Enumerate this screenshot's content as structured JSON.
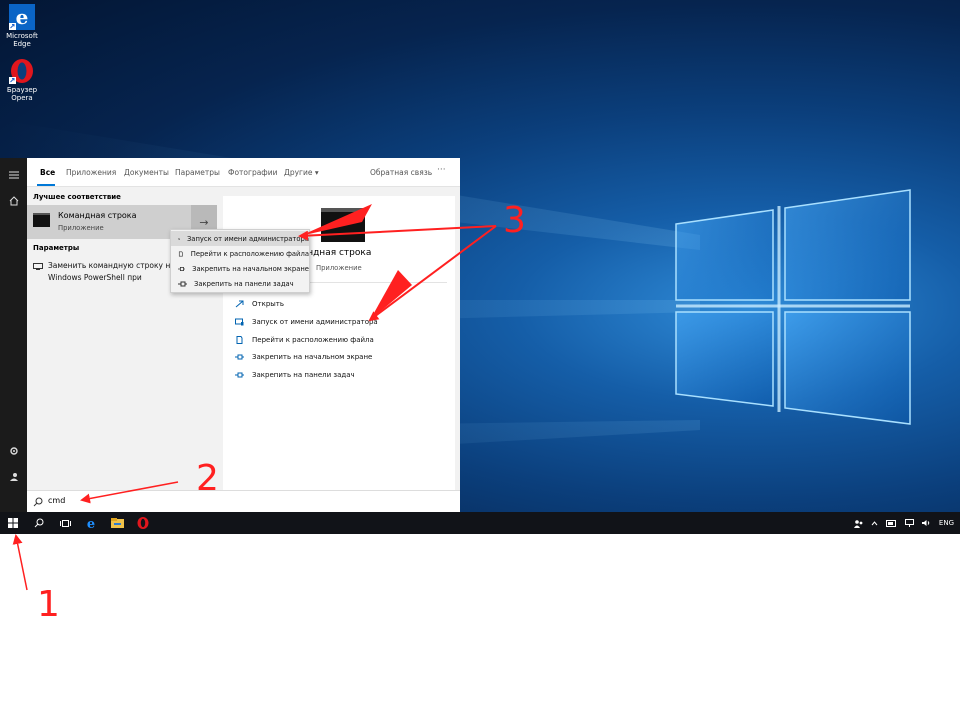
{
  "desktop": {
    "icons": [
      {
        "label_line1": "Microsoft",
        "label_line2": "Edge",
        "icon": "edge-icon"
      },
      {
        "label_line1": "Браузер",
        "label_line2": "Opera",
        "icon": "opera-icon"
      }
    ],
    "accent": "#0b3f7c"
  },
  "start_menu": {
    "tabs": [
      {
        "label": "Все"
      },
      {
        "label": "Приложения"
      },
      {
        "label": "Документы"
      },
      {
        "label": "Параметры"
      },
      {
        "label": "Фотографии"
      },
      {
        "label": "Другие ▾"
      }
    ],
    "feedback": "Обратная связь",
    "more": "···",
    "best_match_title": "Лучшее соответствие",
    "best_match": {
      "name": "Командная строка",
      "type": "Приложение",
      "arrow": "→"
    },
    "settings_title": "Параметры",
    "settings_item": {
      "line1": "Заменить командную строку на",
      "line2": "Windows PowerShell при"
    },
    "preview": {
      "name": "Командная строка",
      "type": "Приложение"
    },
    "actions": [
      {
        "label": "Открыть",
        "icon": "open-icon"
      },
      {
        "label": "Запуск от имени администратора",
        "icon": "run-as-admin-icon"
      },
      {
        "label": "Перейти к расположению файла",
        "icon": "file-location-icon"
      },
      {
        "label": "Закрепить на начальном экране",
        "icon": "pin-start-icon"
      },
      {
        "label": "Закрепить на панели задач",
        "icon": "pin-taskbar-icon"
      }
    ],
    "search_value": "cmd"
  },
  "context_menu": {
    "items": [
      {
        "label": "Запуск от имени администратора",
        "highlighted": true
      },
      {
        "label": "Перейти к расположению файла",
        "highlighted": false
      },
      {
        "label": "Закрепить на начальном экране",
        "highlighted": false
      },
      {
        "label": "Закрепить на панели задач",
        "highlighted": false
      }
    ]
  },
  "taskbar": {
    "language": "ENG",
    "apps": [
      "windows-start-icon",
      "search-icon",
      "task-view-icon",
      "edge-icon",
      "file-explorer-icon",
      "opera-icon"
    ]
  },
  "annotations": {
    "step1": "1",
    "step2": "2",
    "step3": "3",
    "color": "#ff2020"
  }
}
